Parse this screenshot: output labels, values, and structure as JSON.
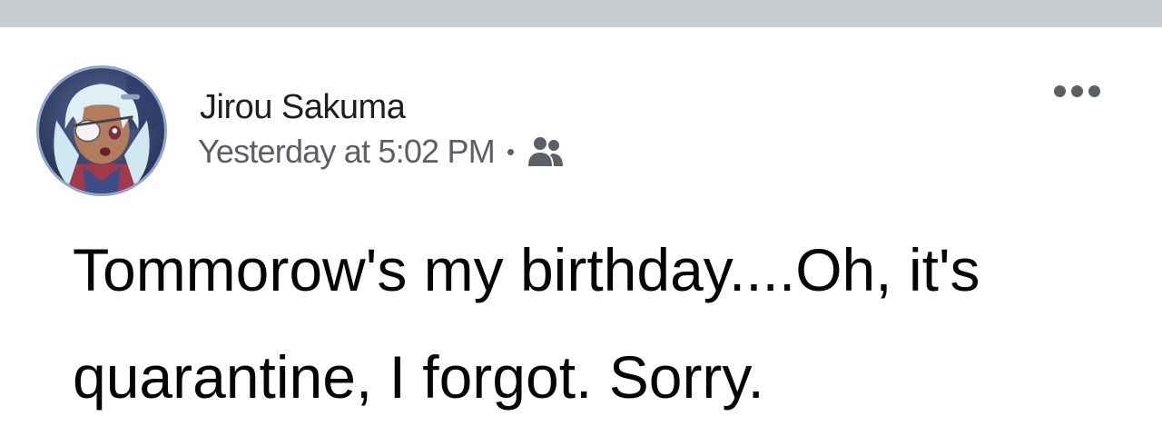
{
  "post": {
    "author": {
      "name": "Jirou Sakuma",
      "avatar_icon": "avatar-anime-character"
    },
    "timestamp": "Yesterday at 5:02 PM",
    "audience_icon": "friends-icon",
    "more_icon": "more-options-icon",
    "text": "Tommorow's my birthday....Oh, it's quarantine, I forgot. Sorry."
  },
  "colors": {
    "divider": "#c9ccd1",
    "name_text": "#1c1e21",
    "meta_text": "#5b5f66",
    "body_text": "#050505",
    "avatar_ring": "#8fa6d4"
  }
}
